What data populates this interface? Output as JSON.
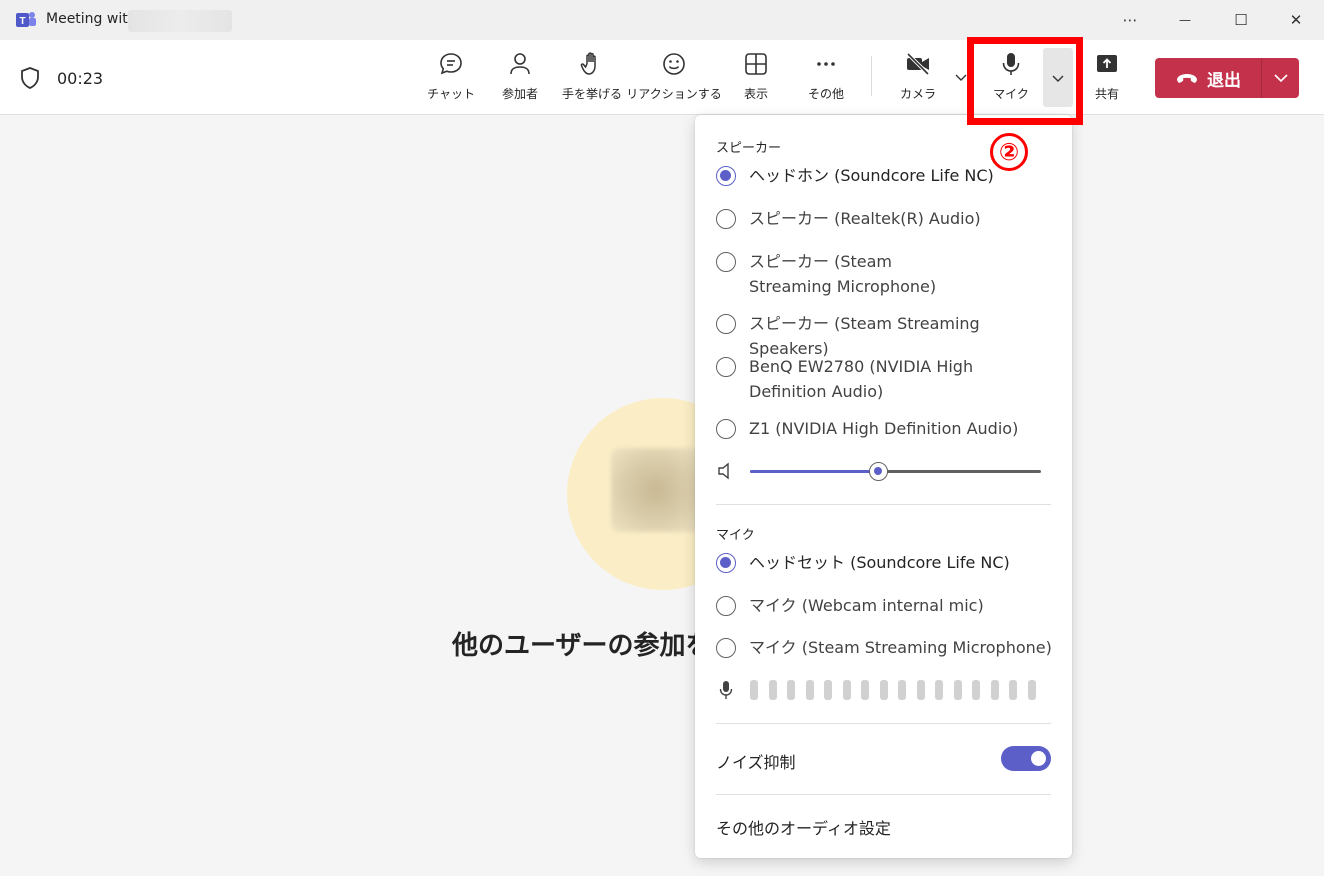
{
  "window": {
    "title": "Meeting with",
    "more_label": "⋯",
    "minimize_label": "—",
    "maximize_label": "☐",
    "close_label": "✕"
  },
  "call": {
    "timer": "00:23",
    "tools": {
      "chat": "チャット",
      "participants": "参加者",
      "raise_hand": "手を挙げる",
      "reactions": "リアクションする",
      "view": "表示",
      "more": "その他",
      "camera": "カメラ",
      "mic": "マイク",
      "share": "共有"
    },
    "leave_label": "退出"
  },
  "stage": {
    "waiting_text": "他のユーザーの参加を"
  },
  "annotation": {
    "number": "②",
    "color": "#ff0000"
  },
  "device_panel": {
    "speaker_section": "スピーカー",
    "speakers": [
      {
        "label": "ヘッドホン (Soundcore Life NC)",
        "selected": true
      },
      {
        "label": "スピーカー (Realtek(R) Audio)",
        "selected": false
      },
      {
        "label": "スピーカー (Steam Streaming Microphone)",
        "selected": false
      },
      {
        "label": "スピーカー (Steam Streaming Speakers)",
        "selected": false
      },
      {
        "label": "BenQ EW2780 (NVIDIA High Definition Audio)",
        "selected": false
      },
      {
        "label": "Z1 (NVIDIA High Definition Audio)",
        "selected": false
      }
    ],
    "speaker_volume_fraction": 0.44,
    "mic_section": "マイク",
    "mics": [
      {
        "label": "ヘッドセット (Soundcore Life NC)",
        "selected": true
      },
      {
        "label": "マイク (Webcam internal mic)",
        "selected": false
      },
      {
        "label": "マイク (Steam Streaming Microphone)",
        "selected": false
      }
    ],
    "noise_suppression_label": "ノイズ抑制",
    "noise_suppression_on": true,
    "more_audio_settings": "その他のオーディオ設定"
  },
  "colors": {
    "accent": "#5b5fc7",
    "leave": "#c4314b"
  }
}
